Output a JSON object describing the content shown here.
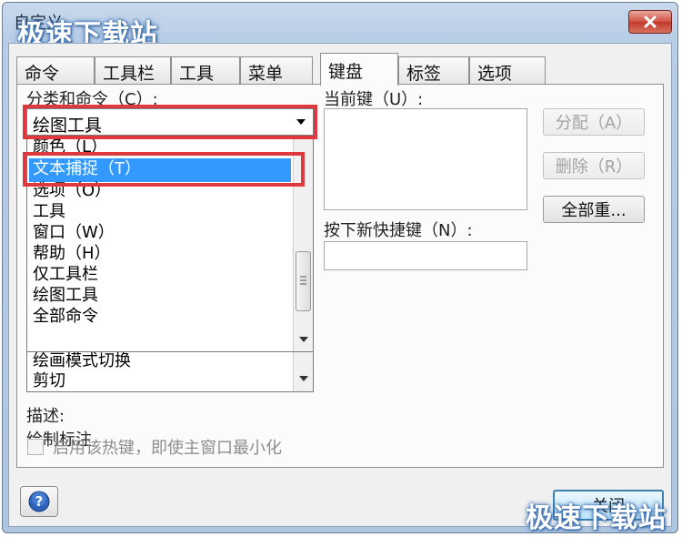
{
  "window": {
    "title": "自定义",
    "watermark": "极速下载站"
  },
  "tabs": [
    {
      "label": "命令"
    },
    {
      "label": "工具栏"
    },
    {
      "label": "工具"
    },
    {
      "label": "菜单"
    },
    {
      "label": "键盘"
    },
    {
      "label": "标签"
    },
    {
      "label": "选项"
    }
  ],
  "active_tab": "键盘",
  "category": {
    "label": "分类和命令（C）:",
    "selected": "绘图工具",
    "options": [
      "颜色（L）",
      "文本捕捉（T）",
      "选项（O）",
      "工具",
      "窗口（W）",
      "帮助（H）",
      "仅工具栏",
      "绘图工具",
      "全部命令"
    ],
    "highlighted_option": "文本捕捉（T）",
    "commands_visible": [
      "绘画模式切换",
      "剪切"
    ]
  },
  "current_key": {
    "label": "当前键（U）:"
  },
  "new_shortcut": {
    "label": "按下新快捷键（N）:",
    "value": ""
  },
  "buttons": {
    "assign": "分配（A）",
    "remove": "删除（R）",
    "reset_all": "全部重...",
    "close": "关闭"
  },
  "description": {
    "label": "描述:",
    "text": "绘制标注"
  },
  "hotkey_option": {
    "label": "启用该热键，即使主窗口最小化",
    "checked": false
  },
  "colors": {
    "highlight_border": "#e0383f",
    "selection": "#3399ff"
  }
}
